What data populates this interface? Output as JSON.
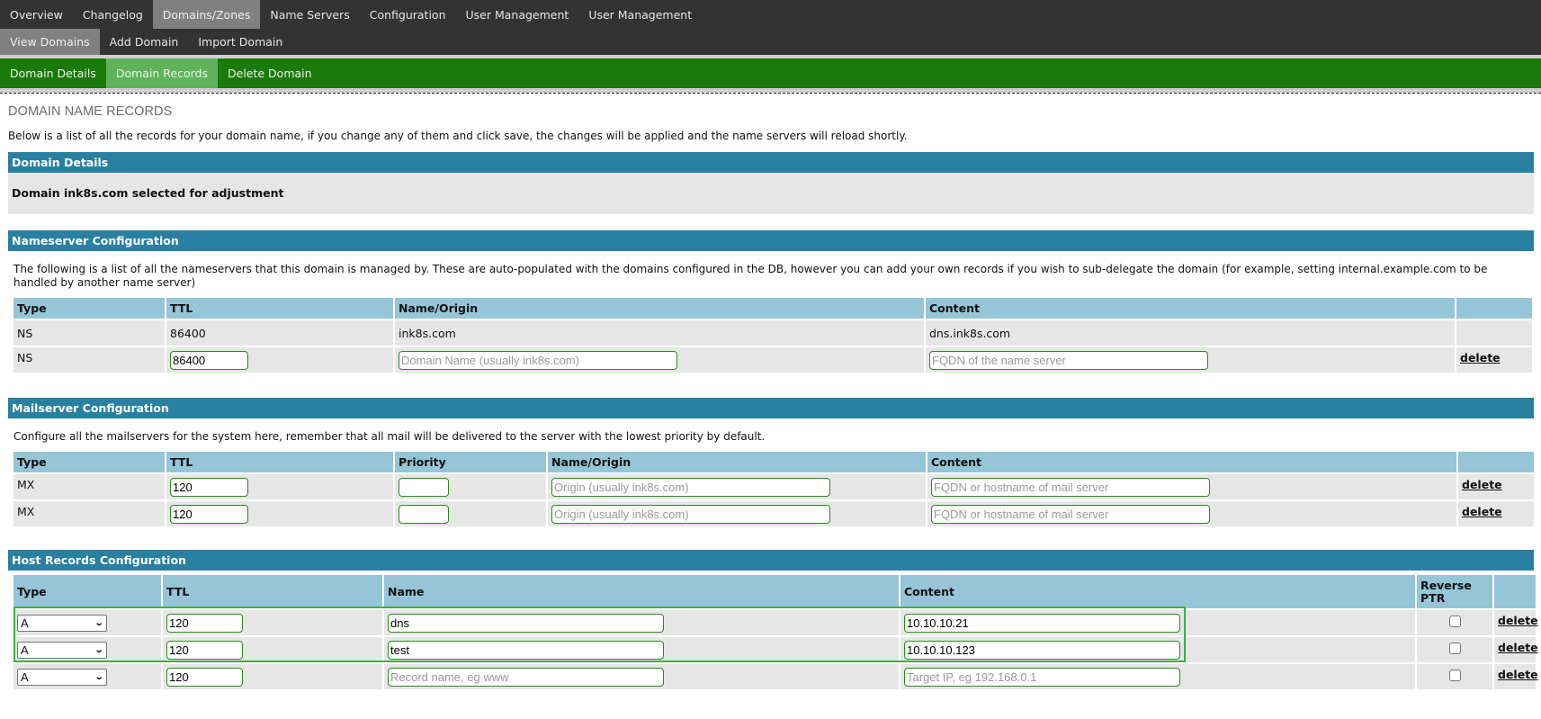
{
  "nav": {
    "top": [
      {
        "label": "Overview",
        "active": false
      },
      {
        "label": "Changelog",
        "active": false
      },
      {
        "label": "Domains/Zones",
        "active": true
      },
      {
        "label": "Name Servers",
        "active": false
      },
      {
        "label": "Configuration",
        "active": false
      },
      {
        "label": "User Management",
        "active": false
      },
      {
        "label": "User Management",
        "active": false
      }
    ],
    "sub": [
      {
        "label": "View Domains",
        "active": true
      },
      {
        "label": "Add Domain",
        "active": false
      },
      {
        "label": "Import Domain",
        "active": false
      }
    ],
    "domain": [
      {
        "label": "Domain Details",
        "active": false
      },
      {
        "label": "Domain Records",
        "active": true
      },
      {
        "label": "Delete Domain",
        "active": false
      }
    ]
  },
  "page": {
    "title": "DOMAIN NAME RECORDS",
    "intro": "Below is a list of all the records for your domain name, if you change any of them and click save, the changes will be applied and the name servers will reload shortly."
  },
  "domain_details": {
    "heading": "Domain Details",
    "text": "Domain ink8s.com selected for adjustment"
  },
  "nameserver": {
    "heading": "Nameserver Configuration",
    "description": "The following is a list of all the nameservers that this domain is managed by. These are auto-populated with the domains configured in the DB, however you can add your own records if you wish to sub-delegate the domain (for example, setting internal.example.com to be handled by another name server)",
    "columns": [
      "Type",
      "TTL",
      "Name/Origin",
      "Content",
      ""
    ],
    "static_row": {
      "type": "NS",
      "ttl": "86400",
      "name": "ink8s.com",
      "content": "dns.ink8s.com"
    },
    "edit_row": {
      "type": "NS",
      "ttl": "86400",
      "name_placeholder": "Domain Name (usually ink8s.com)",
      "content_placeholder": "FQDN of the name server",
      "delete_label": "delete"
    }
  },
  "mailserver": {
    "heading": "Mailserver Configuration",
    "description": "Configure all the mailservers for the system here, remember that all mail will be delivered to the server with the lowest priority by default.",
    "columns": [
      "Type",
      "TTL",
      "Priority",
      "Name/Origin",
      "Content",
      ""
    ],
    "rows": [
      {
        "type": "MX",
        "ttl": "120",
        "priority": "",
        "name_placeholder": "Origin (usually ink8s.com)",
        "content_placeholder": "FQDN or hostname of mail server",
        "delete_label": "delete"
      },
      {
        "type": "MX",
        "ttl": "120",
        "priority": "",
        "name_placeholder": "Origin (usually ink8s.com)",
        "content_placeholder": "FQDN or hostname of mail server",
        "delete_label": "delete"
      }
    ]
  },
  "hosts": {
    "heading": "Host Records Configuration",
    "columns": [
      "Type",
      "TTL",
      "Name",
      "Content",
      "Reverse PTR",
      ""
    ],
    "rows": [
      {
        "type": "A",
        "ttl": "120",
        "name": "dns",
        "name_placeholder": "Record name, eg www",
        "content": "10.10.10.21",
        "content_placeholder": "Target IP, eg 192.168.0.1",
        "reverse_ptr": false,
        "delete_label": "delete"
      },
      {
        "type": "A",
        "ttl": "120",
        "name": "test",
        "name_placeholder": "Record name, eg www",
        "content": "10.10.10.123",
        "content_placeholder": "Target IP, eg 192.168.0.1",
        "reverse_ptr": false,
        "delete_label": "delete"
      },
      {
        "type": "A",
        "ttl": "120",
        "name": "",
        "name_placeholder": "Record name, eg www",
        "content": "",
        "content_placeholder": "Target IP, eg 192.168.0.1",
        "reverse_ptr": false,
        "delete_label": "delete"
      }
    ]
  },
  "colors": {
    "nav_bg": "#333333",
    "nav_active": "#808080",
    "domain_nav_bg": "#1a7a0a",
    "domain_nav_active": "#5fb35a",
    "section_bar": "#2980a0",
    "table_header": "#95c5d7",
    "row_bg": "#e6e6e6",
    "input_border": "#2a8a1a",
    "highlight": "#3cb043"
  }
}
